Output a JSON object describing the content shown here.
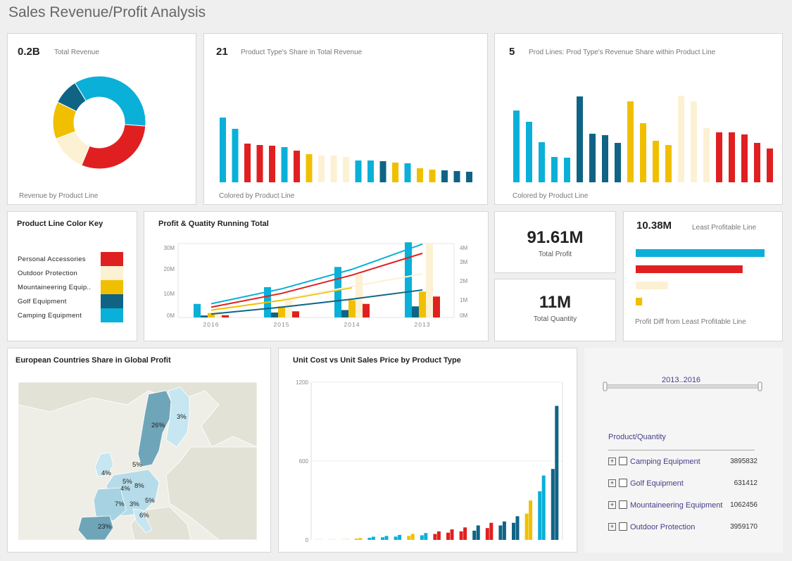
{
  "page_title": "Sales Revenue/Profit Analysis",
  "colors": {
    "personal_accessories": "#e02020",
    "outdoor_protection": "#fdf1d4",
    "mountaineering": "#f0c000",
    "golf": "#0f6485",
    "camping": "#0ab0d8"
  },
  "total_revenue": {
    "value": "0.2B",
    "label": "Total Revenue",
    "footer": "Revenue by Product Line"
  },
  "type_share": {
    "value": "21",
    "label": "Product Type's Share in Total Revenue",
    "footer": "Colored by Product Line"
  },
  "prod_lines": {
    "value": "5",
    "label": "Prod Lines: Prod Type's Revenue Share within Product Line",
    "footer": "Colored by Product Line"
  },
  "color_key": {
    "title": "Product Line Color Key",
    "items": [
      {
        "label": "Personal Accessories",
        "color": "#e02020"
      },
      {
        "label": "Outdoor Protection",
        "color": "#fdf1d4"
      },
      {
        "label": "Mountaineering Equip..",
        "color": "#f0c000"
      },
      {
        "label": "Golf Equipment",
        "color": "#0f6485"
      },
      {
        "label": "Camping Equipment",
        "color": "#0ab0d8"
      }
    ]
  },
  "running_total": {
    "title": "Profit & Quatity Running Total"
  },
  "total_profit": {
    "value": "91.61M",
    "label": "Total Profit"
  },
  "total_quantity": {
    "value": "11M",
    "label": "Total Quantity"
  },
  "least_profitable": {
    "value": "10.38M",
    "label": "Least Profitable Line",
    "footer": "Profit Diff from Least Profitable Line"
  },
  "europe_map": {
    "title": "European Countries Share in Global Profit",
    "labels": [
      "26%",
      "3%",
      "4%",
      "5%",
      "5%",
      "8%",
      "4%",
      "7%",
      "3%",
      "5%",
      "6%",
      "23%"
    ]
  },
  "unit_cost": {
    "title": "Unit Cost vs Unit Sales Price by Product Type"
  },
  "filter": {
    "range_label": "2013..2016",
    "list_header": "Product/Quantity",
    "items": [
      {
        "label": "Camping Equipment",
        "value": "3895832"
      },
      {
        "label": "Golf Equipment",
        "value": "631412"
      },
      {
        "label": "Mountaineering Equipment",
        "value": "1062456"
      },
      {
        "label": "Outdoor Protection",
        "value": "3959170"
      }
    ]
  },
  "chart_data": [
    {
      "type": "pie",
      "title": "Total Revenue",
      "subtitle": "Revenue by Product Line",
      "series": [
        {
          "name": "Camping Equipment",
          "color": "#0ab0d8",
          "value": 0.35
        },
        {
          "name": "Personal Accessories",
          "color": "#e02020",
          "value": 0.3
        },
        {
          "name": "Outdoor Protection",
          "color": "#fdf1d4",
          "value": 0.13
        },
        {
          "name": "Mountaineering Equipment",
          "color": "#f0c000",
          "value": 0.13
        },
        {
          "name": "Golf Equipment",
          "color": "#0f6485",
          "value": 0.09
        }
      ]
    },
    {
      "type": "bar",
      "title": "Product Type's Share in Total Revenue",
      "values": [
        92,
        76,
        55,
        53,
        52,
        50,
        45,
        40,
        38,
        38,
        36,
        31,
        31,
        30,
        28,
        27,
        20,
        18,
        17,
        16,
        15
      ],
      "colors": [
        "#0ab0d8",
        "#0ab0d8",
        "#e02020",
        "#e02020",
        "#e02020",
        "#0ab0d8",
        "#e02020",
        "#f0c000",
        "#fdf1d4",
        "#fdf1d4",
        "#fdf1d4",
        "#0ab0d8",
        "#0ab0d8",
        "#0f6485",
        "#f0c000",
        "#0ab0d8",
        "#f0c000",
        "#f0c000",
        "#0f6485",
        "#0f6485",
        "#0f6485"
      ]
    },
    {
      "type": "bar",
      "title": "Prod Lines: Prod Type's Revenue Share within Product Line",
      "values": [
        102,
        86,
        57,
        36,
        35,
        122,
        69,
        67,
        56,
        115,
        84,
        59,
        53,
        123,
        115,
        77,
        71,
        71,
        68,
        56,
        48
      ],
      "colors": [
        "#0ab0d8",
        "#0ab0d8",
        "#0ab0d8",
        "#0ab0d8",
        "#0ab0d8",
        "#0f6485",
        "#0f6485",
        "#0f6485",
        "#0f6485",
        "#f0c000",
        "#f0c000",
        "#f0c000",
        "#f0c000",
        "#fdf1d4",
        "#fdf1d4",
        "#fdf1d4",
        "#e02020",
        "#e02020",
        "#e02020",
        "#e02020",
        "#e02020"
      ]
    },
    {
      "type": "bar",
      "title": "Profit & Quatity Running Total",
      "categories": [
        "2016",
        "2015",
        "2014",
        "2013"
      ],
      "y_ticks_left": [
        "30M",
        "20M",
        "10M",
        "0M"
      ],
      "y_ticks_right": [
        "4M",
        "3M",
        "2M",
        "1M",
        "0M"
      ],
      "ylim_left": [
        0,
        30
      ],
      "series": [
        {
          "name": "Camping Equipment",
          "color": "#0ab0d8",
          "values": [
            5.5,
            12.3,
            20.5,
            30.5
          ]
        },
        {
          "name": "Golf Equipment",
          "color": "#0f6485",
          "values": [
            0.8,
            2.0,
            3.0,
            4.5
          ]
        },
        {
          "name": "Mountaineering Equipment",
          "color": "#f0c000",
          "values": [
            1.8,
            4.5,
            7.0,
            10.5
          ]
        },
        {
          "name": "Outdoor Protection",
          "color": "#fdf1d4",
          "values": [
            2.5,
            8.0,
            17.5,
            30.0
          ]
        },
        {
          "name": "Personal Accessories",
          "color": "#e02020",
          "values": [
            0.9,
            2.5,
            5.5,
            8.5
          ]
        }
      ],
      "lines": [
        {
          "name": "Camping Equipment",
          "color": "#0ab0d8",
          "values": [
            6.0,
            12.5,
            21.0,
            32.0
          ]
        },
        {
          "name": "Personal Accessories",
          "color": "#e02020",
          "values": [
            4.5,
            10.5,
            18.5,
            28.0
          ]
        },
        {
          "name": "Mountaineering Equipment",
          "color": "#f0c000",
          "values": [
            3.2,
            7.5,
            13.0,
            null
          ]
        },
        {
          "name": "Outdoor Protection",
          "color": "#fdf1d4",
          "values": [
            null,
            8.0,
            13.5,
            19.0
          ]
        },
        {
          "name": "Golf Equipment",
          "color": "#0f6485",
          "values": [
            1.5,
            4.5,
            8.0,
            12.0
          ]
        }
      ]
    },
    {
      "type": "bar",
      "title": "Least Profitable Line",
      "values": [
        100,
        83,
        25,
        5
      ],
      "colors": [
        "#0ab0d8",
        "#e02020",
        "#fdf1d4",
        "#f0c000"
      ]
    },
    {
      "type": "bar",
      "title": "Unit Cost vs Unit Sales Price by Product Type",
      "y_ticks": [
        "1200",
        "600",
        "0"
      ],
      "ylim": [
        0,
        1200
      ],
      "groups": [
        {
          "color": "#fdf1d4",
          "values": [
            2,
            3
          ]
        },
        {
          "color": "#fdf1d4",
          "values": [
            4,
            6
          ]
        },
        {
          "color": "#fdf1d4",
          "values": [
            8,
            12
          ]
        },
        {
          "color": "#f0c000",
          "values": [
            10,
            14
          ]
        },
        {
          "color": "#0ab0d8",
          "values": [
            16,
            24
          ]
        },
        {
          "color": "#0ab0d8",
          "values": [
            20,
            30
          ]
        },
        {
          "color": "#0ab0d8",
          "values": [
            25,
            38
          ]
        },
        {
          "color": "#f0c000",
          "values": [
            30,
            45
          ]
        },
        {
          "color": "#0ab0d8",
          "values": [
            35,
            52
          ]
        },
        {
          "color": "#e02020",
          "values": [
            45,
            65
          ]
        },
        {
          "color": "#e02020",
          "values": [
            55,
            80
          ]
        },
        {
          "color": "#e02020",
          "values": [
            65,
            95
          ]
        },
        {
          "color": "#0f6485",
          "values": [
            70,
            110
          ]
        },
        {
          "color": "#e02020",
          "values": [
            90,
            130
          ]
        },
        {
          "color": "#0f6485",
          "values": [
            110,
            140
          ]
        },
        {
          "color": "#0f6485",
          "values": [
            130,
            180
          ]
        },
        {
          "color": "#f0c000",
          "values": [
            200,
            300
          ]
        },
        {
          "color": "#0ab0d8",
          "values": [
            370,
            490
          ]
        },
        {
          "color": "#0f6485",
          "values": [
            540,
            1020
          ]
        }
      ]
    }
  ]
}
